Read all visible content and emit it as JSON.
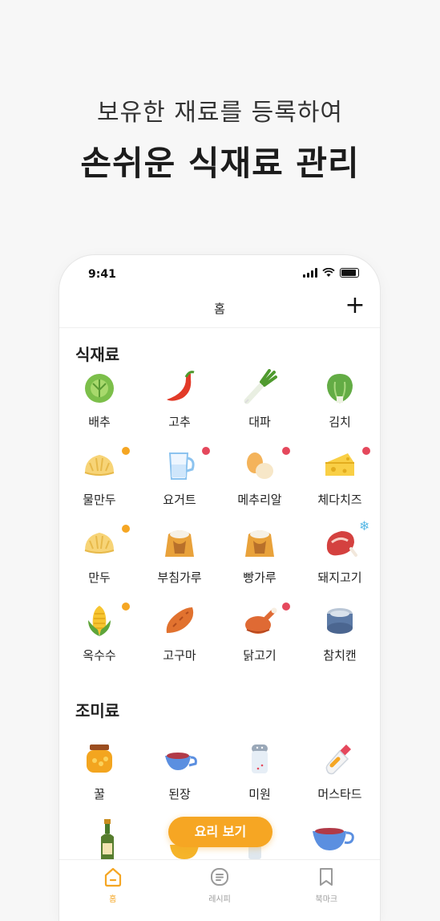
{
  "headline": {
    "line1": "보유한 재료를 등록하여",
    "line2": "손쉬운 식재료 관리"
  },
  "status": {
    "time": "9:41"
  },
  "nav": {
    "title": "홈",
    "add_label": "+"
  },
  "ingredients": {
    "title": "식재료",
    "items": [
      {
        "label": "배추",
        "icon": "cabbage-icon",
        "badge": null
      },
      {
        "label": "고추",
        "icon": "chili-pepper-icon",
        "badge": null
      },
      {
        "label": "대파",
        "icon": "green-onion-icon",
        "badge": null
      },
      {
        "label": "김치",
        "icon": "lettuce-icon",
        "badge": null
      },
      {
        "label": "물만두",
        "icon": "dumpling-icon",
        "badge": "orange"
      },
      {
        "label": "요거트",
        "icon": "yogurt-jug-icon",
        "badge": "red"
      },
      {
        "label": "메추리알",
        "icon": "eggs-icon",
        "badge": "red"
      },
      {
        "label": "체다치즈",
        "icon": "cheese-icon",
        "badge": "red"
      },
      {
        "label": "만두",
        "icon": "dumpling-icon",
        "badge": "orange"
      },
      {
        "label": "부침가루",
        "icon": "flour-sack-icon",
        "badge": null
      },
      {
        "label": "빵가루",
        "icon": "flour-sack-icon",
        "badge": null
      },
      {
        "label": "돼지고기",
        "icon": "steak-icon",
        "badge": "frozen"
      },
      {
        "label": "옥수수",
        "icon": "corn-icon",
        "badge": "orange"
      },
      {
        "label": "고구마",
        "icon": "sweet-potato-icon",
        "badge": null
      },
      {
        "label": "닭고기",
        "icon": "roast-chicken-icon",
        "badge": "red"
      },
      {
        "label": "참치캔",
        "icon": "tuna-can-icon",
        "badge": null
      }
    ]
  },
  "seasonings": {
    "title": "조미료",
    "items": [
      {
        "label": "꿀",
        "icon": "honey-jar-icon"
      },
      {
        "label": "된장",
        "icon": "sauce-boat-icon"
      },
      {
        "label": "미원",
        "icon": "salt-shaker-icon"
      },
      {
        "label": "머스타드",
        "icon": "mustard-bottle-icon"
      }
    ]
  },
  "cook_button": "요리 보기",
  "tabs": [
    {
      "label": "홈",
      "icon": "home-icon",
      "active": true
    },
    {
      "label": "레시피",
      "icon": "recipe-icon",
      "active": false
    },
    {
      "label": "북마크",
      "icon": "bookmark-icon",
      "active": false
    }
  ],
  "colors": {
    "accent": "#f5a623",
    "badge_red": "#e5485c",
    "frozen": "#59b9e6"
  }
}
